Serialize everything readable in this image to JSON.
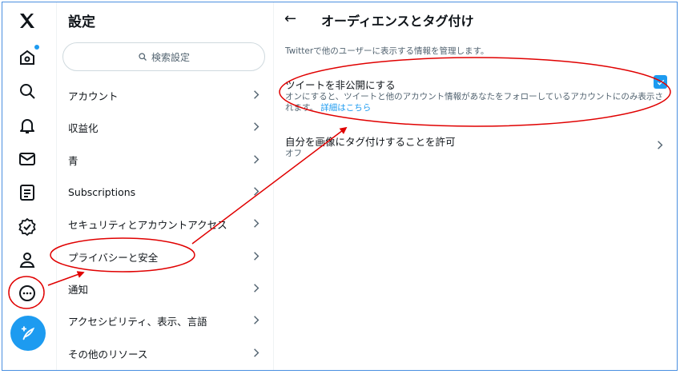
{
  "rail": {
    "icons": [
      "x-logo-icon",
      "home-icon",
      "search-icon",
      "bell-icon",
      "mail-icon",
      "list-icon",
      "verified-icon",
      "profile-icon",
      "more-icon"
    ]
  },
  "settings": {
    "title": "設定",
    "search_label": "検索設定",
    "items": [
      {
        "label": "アカウント"
      },
      {
        "label": "収益化"
      },
      {
        "label": "青"
      },
      {
        "label": "Subscriptions"
      },
      {
        "label": "セキュリティとアカウントアクセス"
      },
      {
        "label": "プライバシーと安全"
      },
      {
        "label": "通知"
      },
      {
        "label": "アクセシビリティ、表示、言語"
      },
      {
        "label": "その他のリソース"
      }
    ]
  },
  "detail": {
    "back": "←",
    "title": "オーディエンスとタグ付け",
    "description": "Twitterで他のユーザーに表示する情報を管理します。",
    "protect": {
      "title": "ツイートを非公開にする",
      "description_1": "オンにすると、ツイートと他のアカウント情報があなたをフォローしているアカウントにのみ表示されます。",
      "link": "詳細はこちら",
      "checked": true
    },
    "tagging": {
      "title": "自分を画像にタグ付けすることを許可",
      "value": "オフ"
    }
  },
  "colors": {
    "accent": "#1d9bf0",
    "annotation": "#e00000",
    "frame": "#4a8fe0"
  }
}
